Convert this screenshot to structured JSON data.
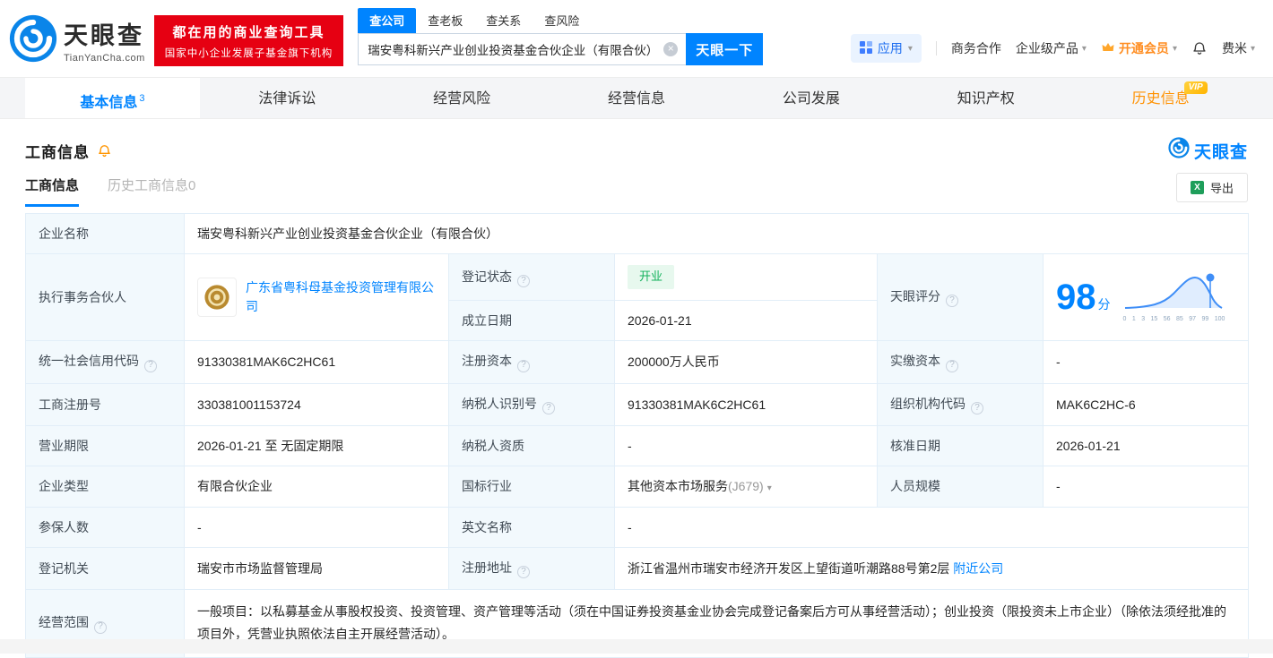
{
  "brand": {
    "name": "天眼查",
    "domain": "TianYanCha.com",
    "slogan_line1": "都在用的商业查询工具",
    "slogan_line2": "国家中小企业发展子基金旗下机构"
  },
  "search": {
    "tabs": [
      "查公司",
      "查老板",
      "查关系",
      "查风险"
    ],
    "value": "瑞安粤科新兴产业创业投资基金合伙企业（有限合伙）",
    "button": "天眼一下"
  },
  "topnav": {
    "apps": "应用",
    "business": "商务合作",
    "enterprise": "企业级产品",
    "vip": "开通会员",
    "user": "费米"
  },
  "nav_tabs": [
    {
      "label": "基本信息",
      "badge": "3"
    },
    {
      "label": "法律诉讼"
    },
    {
      "label": "经营风险"
    },
    {
      "label": "经营信息"
    },
    {
      "label": "公司发展"
    },
    {
      "label": "知识产权"
    },
    {
      "label": "历史信息",
      "vip": "VIP"
    }
  ],
  "section": {
    "title": "工商信息",
    "brand_logo": "天眼查",
    "subtabs": [
      "工商信息",
      "历史工商信息0"
    ],
    "export": "导出"
  },
  "fields": {
    "company_name": {
      "label": "企业名称",
      "value": "瑞安粤科新兴产业创业投资基金合伙企业（有限合伙）"
    },
    "partner": {
      "label": "执行事务合伙人",
      "value": "广东省粤科母基金投资管理有限公司"
    },
    "reg_status": {
      "label": "登记状态",
      "value": "开业"
    },
    "establish_date": {
      "label": "成立日期",
      "value": "2026-01-21"
    },
    "score": {
      "label": "天眼评分",
      "value": "98",
      "unit": "分"
    },
    "credit_code": {
      "label": "统一社会信用代码",
      "value": "91330381MAK6C2HC61"
    },
    "reg_capital": {
      "label": "注册资本",
      "value": "200000万人民币"
    },
    "paid_capital": {
      "label": "实缴资本",
      "value": "-"
    },
    "reg_number": {
      "label": "工商注册号",
      "value": "330381001153724"
    },
    "taxpayer_id": {
      "label": "纳税人识别号",
      "value": "91330381MAK6C2HC61"
    },
    "org_code": {
      "label": "组织机构代码",
      "value": "MAK6C2HC-6"
    },
    "business_term": {
      "label": "营业期限",
      "value": "2026-01-21 至 无固定期限"
    },
    "taxpayer_quality": {
      "label": "纳税人资质",
      "value": "-"
    },
    "approval_date": {
      "label": "核准日期",
      "value": "2026-01-21"
    },
    "company_type": {
      "label": "企业类型",
      "value": "有限合伙企业"
    },
    "industry": {
      "label": "国标行业",
      "value": "其他资本市场服务",
      "code": "(J679)"
    },
    "staff_size": {
      "label": "人员规模",
      "value": "-"
    },
    "insured_count": {
      "label": "参保人数",
      "value": "-"
    },
    "english_name": {
      "label": "英文名称",
      "value": "-"
    },
    "reg_authority": {
      "label": "登记机关",
      "value": "瑞安市市场监督管理局"
    },
    "reg_address": {
      "label": "注册地址",
      "value": "浙江省温州市瑞安市经济开发区上望街道听潮路88号第2层",
      "link": "附近公司"
    },
    "business_scope": {
      "label": "经营范围",
      "value": "一般项目：以私募基金从事股权投资、投资管理、资产管理等活动（须在中国证券投资基金业协会完成登记备案后方可从事经营活动）；创业投资（限投资未上市企业）（除依法须经批准的项目外，凭营业执照依法自主开展经营活动）。"
    }
  },
  "score_chart": {
    "type": "area",
    "ticks": [
      "0",
      "1",
      "3",
      "15",
      "56",
      "85",
      "97",
      "99",
      "100"
    ],
    "marker_value": "98"
  },
  "colors": {
    "primary": "#0084ff",
    "banner_red": "#e60012",
    "status_green": "#12b15b",
    "vip_orange": "#ff9100"
  }
}
